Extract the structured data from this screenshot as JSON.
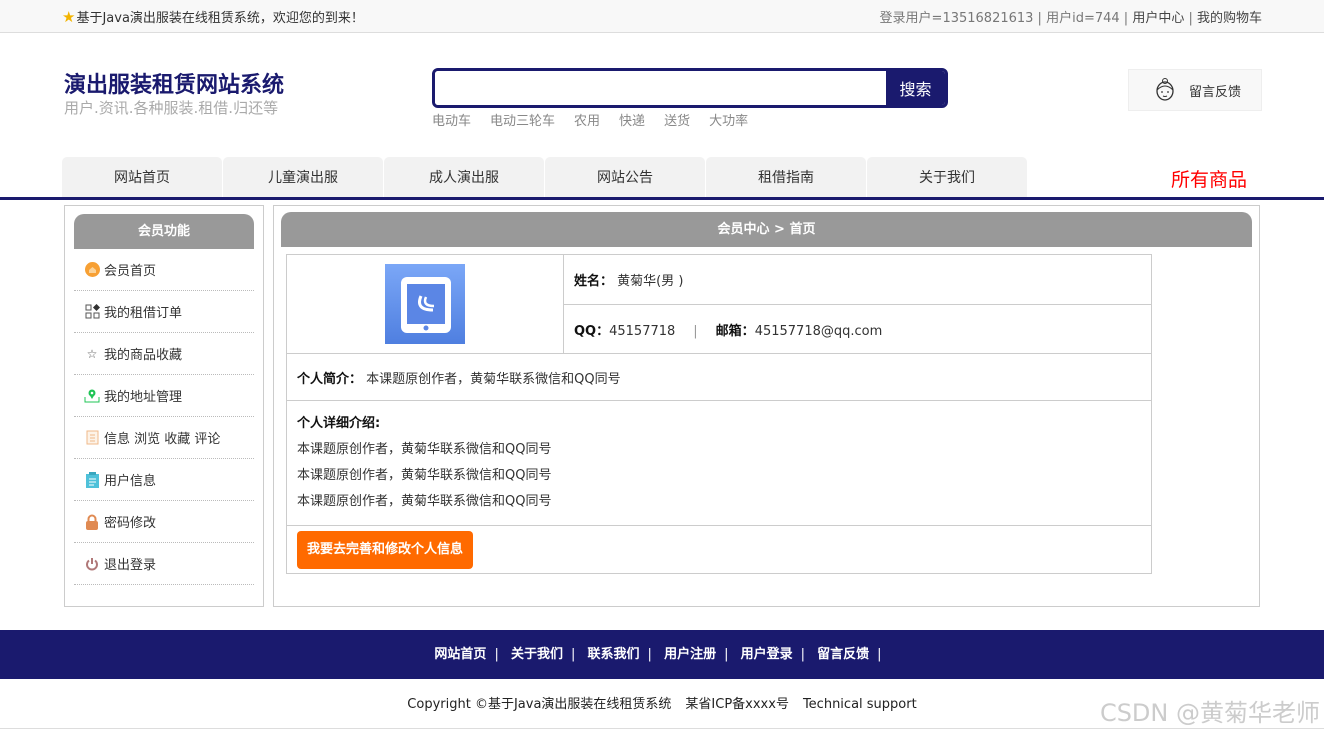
{
  "topbar": {
    "welcome": "基于Java演出服装在线租赁系统，欢迎您的到来！",
    "login_user": "登录用户=13516821613",
    "user_id": "用户id=744",
    "user_center": "用户中心",
    "cart": "我的购物车"
  },
  "header": {
    "title": "演出服装租赁网站系统",
    "subtitle": "用户.资讯.各种服装.租借.归还等",
    "search_placeholder": "",
    "search_button": "搜索",
    "hot_words": [
      "电动车",
      "电动三轮车",
      "农用",
      "快递",
      "送货",
      "大功率"
    ],
    "feedback": "留言反馈"
  },
  "nav": {
    "items": [
      "网站首页",
      "儿童演出服",
      "成人演出服",
      "网站公告",
      "租借指南",
      "关于我们"
    ],
    "all_goods": "所有商品"
  },
  "sidebar": {
    "title": "会员功能",
    "items": [
      {
        "label": "会员首页",
        "icon": "home-icon",
        "color": "#f7a034"
      },
      {
        "label": "我的租借订单",
        "icon": "grid-icon",
        "color": "#555"
      },
      {
        "label": "我的商品收藏",
        "icon": "star-icon",
        "color": "#555"
      },
      {
        "label": "我的地址管理",
        "icon": "location-icon",
        "color": "#1fc455"
      },
      {
        "label": "信息 浏览 收藏 评论",
        "icon": "document-icon",
        "color": "#f0b98a"
      },
      {
        "label": "用户信息",
        "icon": "clipboard-icon",
        "color": "#4fc1d9"
      },
      {
        "label": "密码修改",
        "icon": "lock-icon",
        "color": "#e08a52"
      },
      {
        "label": "退出登录",
        "icon": "power-icon",
        "color": "#b07878"
      }
    ]
  },
  "main": {
    "breadcrumb": "会员中心 > 首页",
    "name_label": "姓名：",
    "name_value": "黄菊华(男 )",
    "qq_label": "QQ：",
    "qq_value": "45157718",
    "email_label": "邮箱：",
    "email_value": "45157718@qq.com",
    "intro_label": "个人简介：",
    "intro_value": "本课题原创作者，黄菊华联系微信和QQ同号",
    "detail_label": "个人详细介绍:",
    "detail_lines": [
      "本课题原创作者，黄菊华联系微信和QQ同号",
      "本课题原创作者，黄菊华联系微信和QQ同号",
      "本课题原创作者，黄菊华联系微信和QQ同号"
    ],
    "edit_button": "我要去完善和修改个人信息"
  },
  "footer": {
    "links": [
      "网站首页",
      "关于我们",
      "联系我们",
      "用户注册",
      "用户登录",
      "留言反馈"
    ],
    "copyright": "Copyright ©基于Java演出服装在线租赁系统",
    "icp": "某省ICP备xxxx号",
    "support": "Technical support",
    "watermark": "CSDN @黄菊华老师"
  }
}
